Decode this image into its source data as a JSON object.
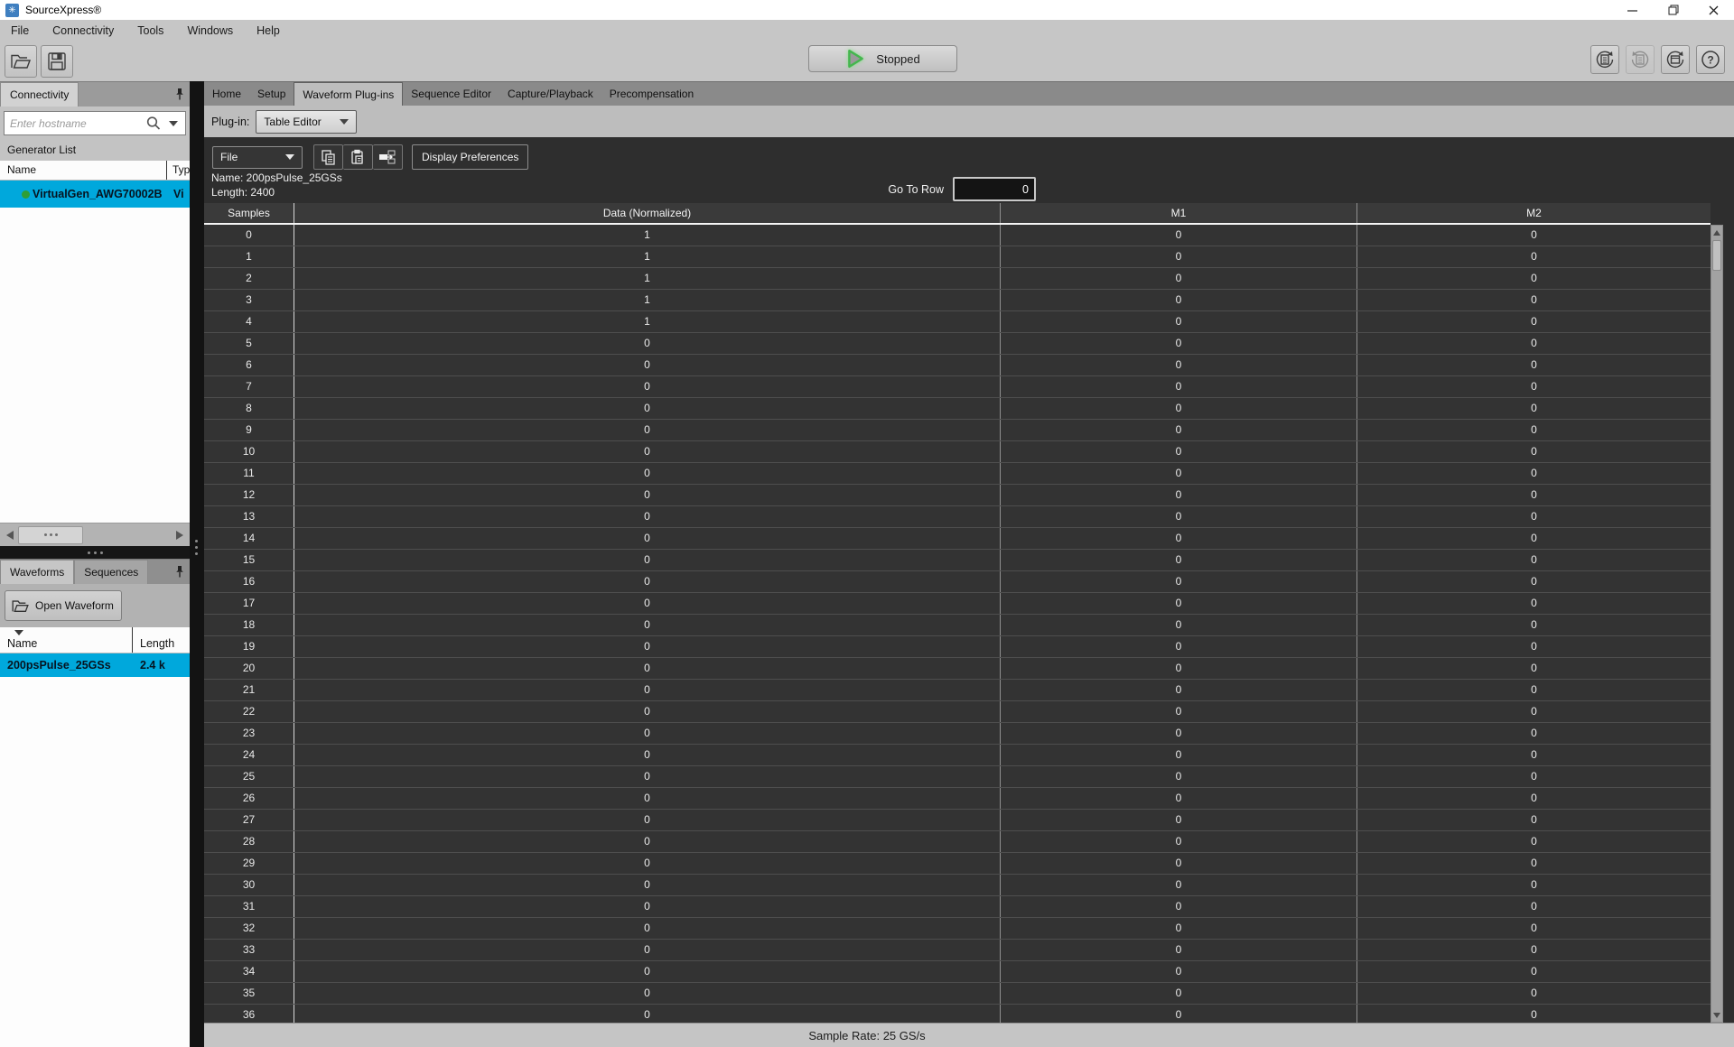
{
  "window": {
    "title": "SourceXpress®"
  },
  "menu": {
    "items": [
      "File",
      "Connectivity",
      "Tools",
      "Windows",
      "Help"
    ]
  },
  "toolbar": {
    "run_button": "Stopped"
  },
  "connectivity": {
    "tab": "Connectivity",
    "search_placeholder": "Enter hostname",
    "section_label": "Generator List",
    "columns": {
      "name": "Name",
      "type": "Typ"
    },
    "generator": {
      "name": "VirtualGen_AWG70002B",
      "type": "Vi"
    }
  },
  "waveforms": {
    "tab_waveforms": "Waveforms",
    "tab_sequences": "Sequences",
    "open_button": "Open Waveform",
    "columns": {
      "name": "Name",
      "length": "Length"
    },
    "rows": [
      {
        "name": "200psPulse_25GSs",
        "length": "2.4 k"
      }
    ]
  },
  "main": {
    "tabs": [
      "Home",
      "Setup",
      "Waveform Plug-ins",
      "Sequence Editor",
      "Capture/Playback",
      "Precompensation"
    ],
    "active_tab": "Waveform Plug-ins",
    "plugin_label": "Plug-in:",
    "plugin_value": "Table Editor"
  },
  "editor": {
    "file_menu": "File",
    "display_preferences": "Display Preferences",
    "waveform_name": "Name: 200psPulse_25GSs",
    "waveform_length": "Length: 2400",
    "goto_label": "Go To Row",
    "goto_value": "0"
  },
  "table": {
    "headers": [
      "Samples",
      "Data (Normalized)",
      "M1",
      "M2"
    ],
    "rows": [
      [
        0,
        1,
        0,
        0
      ],
      [
        1,
        1,
        0,
        0
      ],
      [
        2,
        1,
        0,
        0
      ],
      [
        3,
        1,
        0,
        0
      ],
      [
        4,
        1,
        0,
        0
      ],
      [
        5,
        0,
        0,
        0
      ],
      [
        6,
        0,
        0,
        0
      ],
      [
        7,
        0,
        0,
        0
      ],
      [
        8,
        0,
        0,
        0
      ],
      [
        9,
        0,
        0,
        0
      ],
      [
        10,
        0,
        0,
        0
      ],
      [
        11,
        0,
        0,
        0
      ],
      [
        12,
        0,
        0,
        0
      ],
      [
        13,
        0,
        0,
        0
      ],
      [
        14,
        0,
        0,
        0
      ],
      [
        15,
        0,
        0,
        0
      ],
      [
        16,
        0,
        0,
        0
      ],
      [
        17,
        0,
        0,
        0
      ],
      [
        18,
        0,
        0,
        0
      ],
      [
        19,
        0,
        0,
        0
      ],
      [
        20,
        0,
        0,
        0
      ],
      [
        21,
        0,
        0,
        0
      ],
      [
        22,
        0,
        0,
        0
      ],
      [
        23,
        0,
        0,
        0
      ],
      [
        24,
        0,
        0,
        0
      ],
      [
        25,
        0,
        0,
        0
      ],
      [
        26,
        0,
        0,
        0
      ],
      [
        27,
        0,
        0,
        0
      ],
      [
        28,
        0,
        0,
        0
      ],
      [
        29,
        0,
        0,
        0
      ],
      [
        30,
        0,
        0,
        0
      ],
      [
        31,
        0,
        0,
        0
      ],
      [
        32,
        0,
        0,
        0
      ],
      [
        33,
        0,
        0,
        0
      ],
      [
        34,
        0,
        0,
        0
      ],
      [
        35,
        0,
        0,
        0
      ],
      [
        36,
        0,
        0,
        0
      ]
    ]
  },
  "status": {
    "text": "Sample Rate: 25 GS/s"
  },
  "colors": {
    "selection": "#00a8dc",
    "status_green": "#2f9e36",
    "play_green": "#44b64e"
  }
}
